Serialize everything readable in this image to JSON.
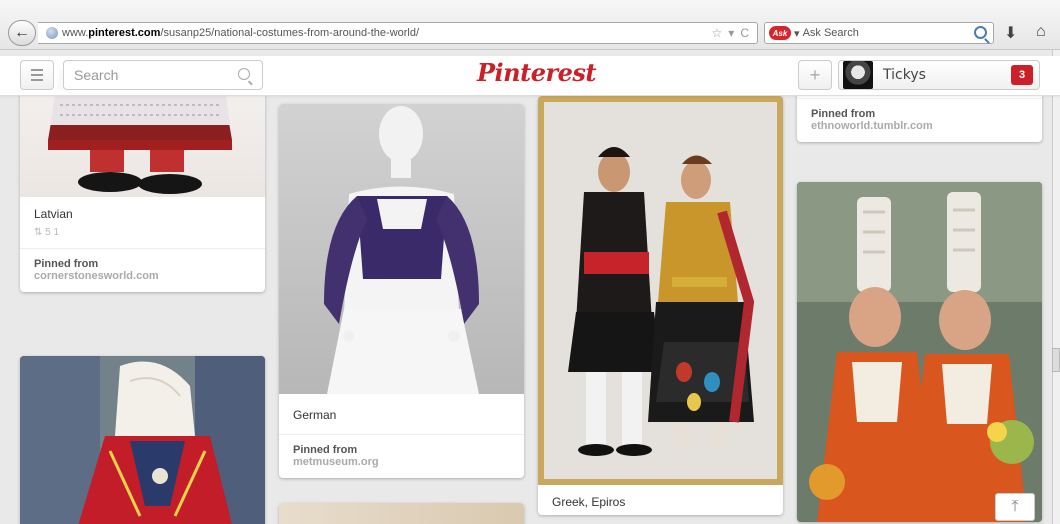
{
  "browser": {
    "url_host": "www.",
    "url_domain": "pinterest.com",
    "url_path": "/susanp25/national-costumes-from-around-the-world/",
    "search_placeholder": "Ask Search",
    "search_brand": "Ask"
  },
  "header": {
    "search_placeholder": "Search",
    "logo": "Pinterest",
    "user_name": "Tickys",
    "notifications": "3"
  },
  "pins": [
    {
      "desc": "Latvian",
      "stats": "5  1",
      "pinned_label": "Pinned from",
      "source": "cornerstonesworld.com"
    },
    {
      "desc": "German",
      "pinned_label": "Pinned from",
      "source": "metmuseum.org"
    },
    {
      "desc": "Greek, Epiros"
    },
    {
      "pinned_label": "Pinned from",
      "source": "ethnoworld.tumblr.com"
    }
  ],
  "colors": {
    "brand": "#cb2027",
    "background": "#e9e9e9"
  },
  "icons": {
    "back": "←",
    "scroll_top": "⤒"
  }
}
